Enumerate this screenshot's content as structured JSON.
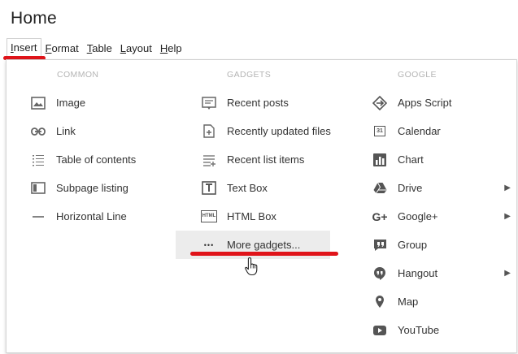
{
  "page": {
    "title": "Home"
  },
  "menubar": [
    {
      "pre": "",
      "mn": "I",
      "post": "nsert",
      "active": true
    },
    {
      "pre": "",
      "mn": "F",
      "post": "ormat",
      "active": false
    },
    {
      "pre": "",
      "mn": "T",
      "post": "able",
      "active": false
    },
    {
      "pre": "",
      "mn": "L",
      "post": "ayout",
      "active": false
    },
    {
      "pre": "",
      "mn": "H",
      "post": "elp",
      "active": false
    }
  ],
  "columns": {
    "common": {
      "header": "COMMON",
      "items": [
        {
          "label": "Image",
          "icon": "image-icon"
        },
        {
          "label": "Link",
          "icon": "link-icon"
        },
        {
          "label": "Table of contents",
          "icon": "table-of-contents-icon"
        },
        {
          "label": "Subpage listing",
          "icon": "subpage-listing-icon"
        },
        {
          "label": "Horizontal Line",
          "icon": "horizontal-line-icon"
        }
      ]
    },
    "gadgets": {
      "header": "GADGETS",
      "items": [
        {
          "label": "Recent posts",
          "icon": "recent-posts-icon"
        },
        {
          "label": "Recently updated files",
          "icon": "recently-updated-files-icon"
        },
        {
          "label": "Recent list items",
          "icon": "recent-list-items-icon"
        },
        {
          "label": "Text Box",
          "icon": "text-box-icon"
        },
        {
          "label": "HTML Box",
          "icon": "html-box-icon",
          "icon_text": "HTML"
        },
        {
          "label": "More gadgets...",
          "icon": "more-dots-icon",
          "highlighted": true
        }
      ]
    },
    "google": {
      "header": "GOOGLE",
      "items": [
        {
          "label": "Apps Script",
          "icon": "apps-script-icon"
        },
        {
          "label": "Calendar",
          "icon": "calendar-icon",
          "icon_text": "31"
        },
        {
          "label": "Chart",
          "icon": "chart-icon"
        },
        {
          "label": "Drive",
          "icon": "drive-icon",
          "submenu": true
        },
        {
          "label": "Google+",
          "icon": "google-plus-icon",
          "icon_text": "G+",
          "submenu": true
        },
        {
          "label": "Group",
          "icon": "group-icon"
        },
        {
          "label": "Hangout",
          "icon": "hangout-icon",
          "submenu": true
        },
        {
          "label": "Map",
          "icon": "map-pin-icon"
        },
        {
          "label": "YouTube",
          "icon": "youtube-icon"
        }
      ]
    }
  },
  "glyphs": {
    "submenu_arrow": "▶",
    "dots": "•••"
  },
  "colors": {
    "accent_red": "#e0141a",
    "highlight_bg": "#ececec",
    "icon_gray": "#666666"
  }
}
